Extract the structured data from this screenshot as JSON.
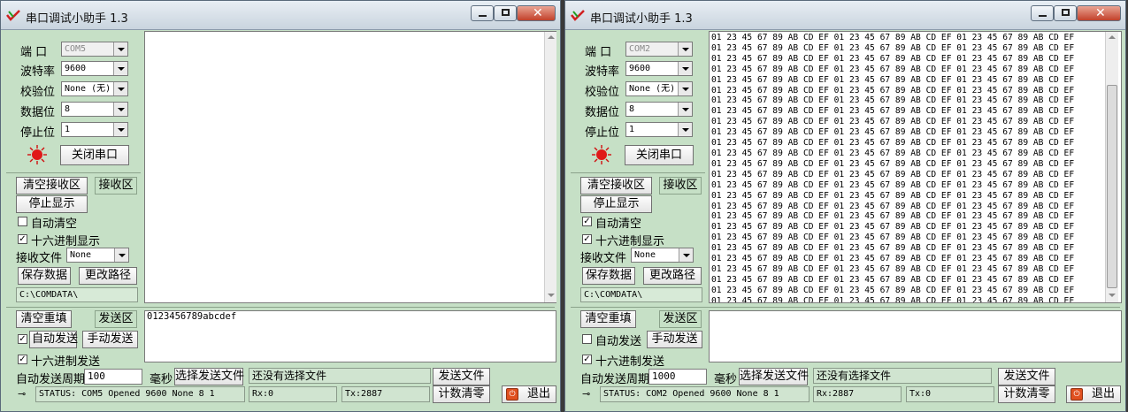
{
  "windows": [
    {
      "title": "串口调试小助手 1.3",
      "port": {
        "label": "端  口",
        "value": "COM5"
      },
      "baud": {
        "label": "波特率",
        "value": "9600"
      },
      "parity": {
        "label": "校验位",
        "value": "None (无)"
      },
      "databits": {
        "label": "数据位",
        "value": "8"
      },
      "stopbits": {
        "label": "停止位",
        "value": "1"
      },
      "close_port": "关闭串口",
      "clear_rx": "清空接收区",
      "rx_area": "接收区",
      "stop_display": "停止显示",
      "auto_clear": {
        "label": "自动清空",
        "checked": false
      },
      "hex_display": {
        "label": "十六进制显示",
        "checked": true
      },
      "rx_file": {
        "label": "接收文件",
        "value": "None"
      },
      "save_data": "保存数据",
      "change_path": "更改路径",
      "path": "C:\\COMDATA\\",
      "rx_text": "",
      "clear_refill": "清空重填",
      "tx_area": "发送区",
      "tx_text": "0123456789abcdef",
      "auto_send": {
        "label": "自动发送",
        "checked": true
      },
      "manual_send": "手动发送",
      "hex_send": {
        "label": "十六进制发送",
        "checked": true
      },
      "period": {
        "label": "自动发送周期",
        "value": "100",
        "unit": "毫秒"
      },
      "select_file": "选择发送文件",
      "no_file": "还没有选择文件",
      "send_file": "发送文件",
      "status": "STATUS: COM5 Opened 9600 None  8 1",
      "rx_count": "Rx:0",
      "tx_count": "Tx:2887",
      "reset_count": "计数清零",
      "exit": "退出"
    },
    {
      "title": "串口调试小助手 1.3",
      "port": {
        "label": "端  口",
        "value": "COM2"
      },
      "baud": {
        "label": "波特率",
        "value": "9600"
      },
      "parity": {
        "label": "校验位",
        "value": "None (无)"
      },
      "databits": {
        "label": "数据位",
        "value": "8"
      },
      "stopbits": {
        "label": "停止位",
        "value": "1"
      },
      "close_port": "关闭串口",
      "clear_rx": "清空接收区",
      "rx_area": "接收区",
      "stop_display": "停止显示",
      "auto_clear": {
        "label": "自动清空",
        "checked": true
      },
      "hex_display": {
        "label": "十六进制显示",
        "checked": true
      },
      "rx_file": {
        "label": "接收文件",
        "value": "None"
      },
      "save_data": "保存数据",
      "change_path": "更改路径",
      "path": "C:\\COMDATA\\",
      "rx_text": "01 23 45 67 89 AB CD EF 01 23 45 67 89 AB CD EF 01 23 45 67 89 AB CD EF\n01 23 45 67 89 AB CD EF 01 23 45 67 89 AB CD EF 01 23 45 67 89 AB CD EF\n01 23 45 67 89 AB CD EF 01 23 45 67 89 AB CD EF 01 23 45 67 89 AB CD EF\n01 23 45 67 89 AB CD EF 01 23 45 67 89 AB CD EF 01 23 45 67 89 AB CD EF\n01 23 45 67 89 AB CD EF 01 23 45 67 89 AB CD EF 01 23 45 67 89 AB CD EF\n01 23 45 67 89 AB CD EF 01 23 45 67 89 AB CD EF 01 23 45 67 89 AB CD EF\n01 23 45 67 89 AB CD EF 01 23 45 67 89 AB CD EF 01 23 45 67 89 AB CD EF\n01 23 45 67 89 AB CD EF 01 23 45 67 89 AB CD EF 01 23 45 67 89 AB CD EF\n01 23 45 67 89 AB CD EF 01 23 45 67 89 AB CD EF 01 23 45 67 89 AB CD EF\n01 23 45 67 89 AB CD EF 01 23 45 67 89 AB CD EF 01 23 45 67 89 AB CD EF\n01 23 45 67 89 AB CD EF 01 23 45 67 89 AB CD EF 01 23 45 67 89 AB CD EF\n01 23 45 67 89 AB CD EF 01 23 45 67 89 AB CD EF 01 23 45 67 89 AB CD EF\n01 23 45 67 89 AB CD EF 01 23 45 67 89 AB CD EF 01 23 45 67 89 AB CD EF\n01 23 45 67 89 AB CD EF 01 23 45 67 89 AB CD EF 01 23 45 67 89 AB CD EF\n01 23 45 67 89 AB CD EF 01 23 45 67 89 AB CD EF 01 23 45 67 89 AB CD EF\n01 23 45 67 89 AB CD EF 01 23 45 67 89 AB CD EF 01 23 45 67 89 AB CD EF\n01 23 45 67 89 AB CD EF 01 23 45 67 89 AB CD EF 01 23 45 67 89 AB CD EF\n01 23 45 67 89 AB CD EF 01 23 45 67 89 AB CD EF 01 23 45 67 89 AB CD EF\n01 23 45 67 89 AB CD EF 01 23 45 67 89 AB CD EF 01 23 45 67 89 AB CD EF\n01 23 45 67 89 AB CD EF 01 23 45 67 89 AB CD EF 01 23 45 67 89 AB CD EF\n01 23 45 67 89 AB CD EF 01 23 45 67 89 AB CD EF 01 23 45 67 89 AB CD EF\n01 23 45 67 89 AB CD EF 01 23 45 67 89 AB CD EF 01 23 45 67 89 AB CD EF\n01 23 45 67 89 AB CD EF 01 23 45 67 89 AB CD EF 01 23 45 67 89 AB CD EF\n01 23 45 67 89 AB CD EF 01 23 45 67 89 AB CD EF 01 23 45 67 89 AB CD EF\n01 23 45 67 89 AB CD EF 01 23 45 67 89 AB CD EF 01 23 45 67 89 AB CD EF\n01 23 45 67 89 AB CD EF 01 23 45 67 89 AB CD EF 01 23 45 67 89 AB CD EF\n01 23 45 67 89 AB CD EF 01 23 45 67 89 AB CD EF 01 23 45 67 89 AB CD EF\n01 23 45 67 89 AB CD EF 01 23 45 67 89 AB CD EF 01 23 45 67 89 AB CD EF\n01 23 45 67 89 AB CD EF 01 23 45 67 89 AB CD EF 01 23 45 67 89 AB CD EF\n01 23 45 67 89 AB CD EF 01 23 45 67 89 AB CD EF 01 23 45 67 89 AB CD EF\n01 23 45 67 89 AB CD EF 01 23 45 67 89 AB CD EF 01 23 45 67 89 AB CD EF\n01 23 45 67 89 AB CD EF 01 23 45 67 89 AB CD EF 01 23 45 67 89 AB CD EF\n01 23 45 67 89 AB CD EF 01 23 45 67 89 AB CD EF 01 23 45 67 89 AB CD EF\n01 23 45 67 89 AB CD EF 01 23 45 67 89 AB CD EF 01 23 45 67 89 AB CD EF\n01 23 45 67 89 AB CD EF 01 23 45 67 89 AB CD EF 01 23 45 67 89 AB CD EF\n01 23 45 67 89 AB CD EF 01 23 45 67 89 AB CD EF 01 23 45 67 89 AB CD EF\n01 23 45 67 89 AB CD EF 01 23 45 67 89 AB CD EF 01 23 45 67 89 AB CD EF\n01 23 45 67 89 AB CD EF 01 23 45 67 89 AB CD EF 01 23 45 67 89 AB CD EF\n01 23 45 67 89 AB CD EF 01 23 45 67 89 AB CD EF 01 23 45 67 89 AB CD EF\n01 23 45 67 89 AB CD EF 01 23 45 67 89 AB CD EF 01 23 45 67 89 AB CD EF\n01 23 45 67 89 AB CD EF 01 23 45 67 89 AB CD EF 01 23 45 67 89 AB CD EF\n01 23 45 67 89 AB CD EF 01 23 45 67 89 AB CD EF 01 23 45 67 89 AB CD EF\n01 23 45 67 89 AB CD EF 01 23 45 67 89 AB CD EF 01 23 45 67 89 AB CD EF\n01 23 45 67 89 AB CD EF 01 23 45 67 89 AB CD EF 01 23 45 67 89 AB CD EF\n01 23 45 67 89 AB CD EF 01 23 45 67 89 AB CD EF 01 23 45 67 89 AB CD EF\n01 23 45 67 89 AB CD EF 01 23 45 67 89 AB CD EF 01 23 45 67 89 AB CD EF\n01 23 45 67 89 AB CD EF 01 23 45 67 89 AB CD EF 01 23 45 67 89 AB CD EF\n01 23 45 67 89 AB CD EF 01 23 45 67 89 AB CD EF 01 23 45 67 89 AB CD EF\n01 23 45 67 89 AB CD EF 01 23 45 67 89 AB CD EF 01 23 45 67 89 AB CD EF\n01 23 45 67 89 AB CD EF 01 23 45 67 89 AB CD EF 01 23 45 67 89 AB CD EF\n01 23 45 67 89 AB CD EF 01 23 45 67 89 AB CD EF 01 23 45 67 89 AB CD EF\n01 23 45 67 89 AB CD EF 01 23 45 67 89 AB CD EF 01 23 45 67 89 AB CD EF\n01 23 45 67 89 AB CD EF 01 23 45 67 89 AB CD EF 01 23 45 67 89 AB CD EF\n01 23 45 67 89 AB CD EF 01 23 45 67 89 AB CD EF 01 23 45 67 89 AB CD EF\n01 23 45 67 89 AB CD EF 01 23 45 67 89 AB CD EF 01 23 45 67 89 AB CD EF\n01 23 45 67 89 AB CD EF 01 23 45 67 89 AB CD EF 01 23 45 67 89 AB CD EF\n01 23 45 67 89 AB CD EF 01 23 45 67 89 AB CD EF",
      "clear_refill": "清空重填",
      "tx_area": "发送区",
      "tx_text": "",
      "auto_send": {
        "label": "自动发送",
        "checked": false
      },
      "manual_send": "手动发送",
      "hex_send": {
        "label": "十六进制发送",
        "checked": true
      },
      "period": {
        "label": "自动发送周期",
        "value": "1000",
        "unit": "毫秒"
      },
      "select_file": "选择发送文件",
      "no_file": "还没有选择文件",
      "send_file": "发送文件",
      "status": "STATUS: COM2 Opened 9600 None  8 1",
      "rx_count": "Rx:2887",
      "tx_count": "Tx:0",
      "reset_count": "计数清零",
      "exit": "退出"
    }
  ],
  "icons": {
    "title": "app-icon",
    "lamp": "indicator-lamp-icon",
    "pin": "pin-icon",
    "exit": "exit-icon"
  },
  "colors": {
    "panel": "#c6e0c6",
    "lamp": "#e01818",
    "titlebar": "#dbe4ec",
    "close": "#c9452e"
  }
}
